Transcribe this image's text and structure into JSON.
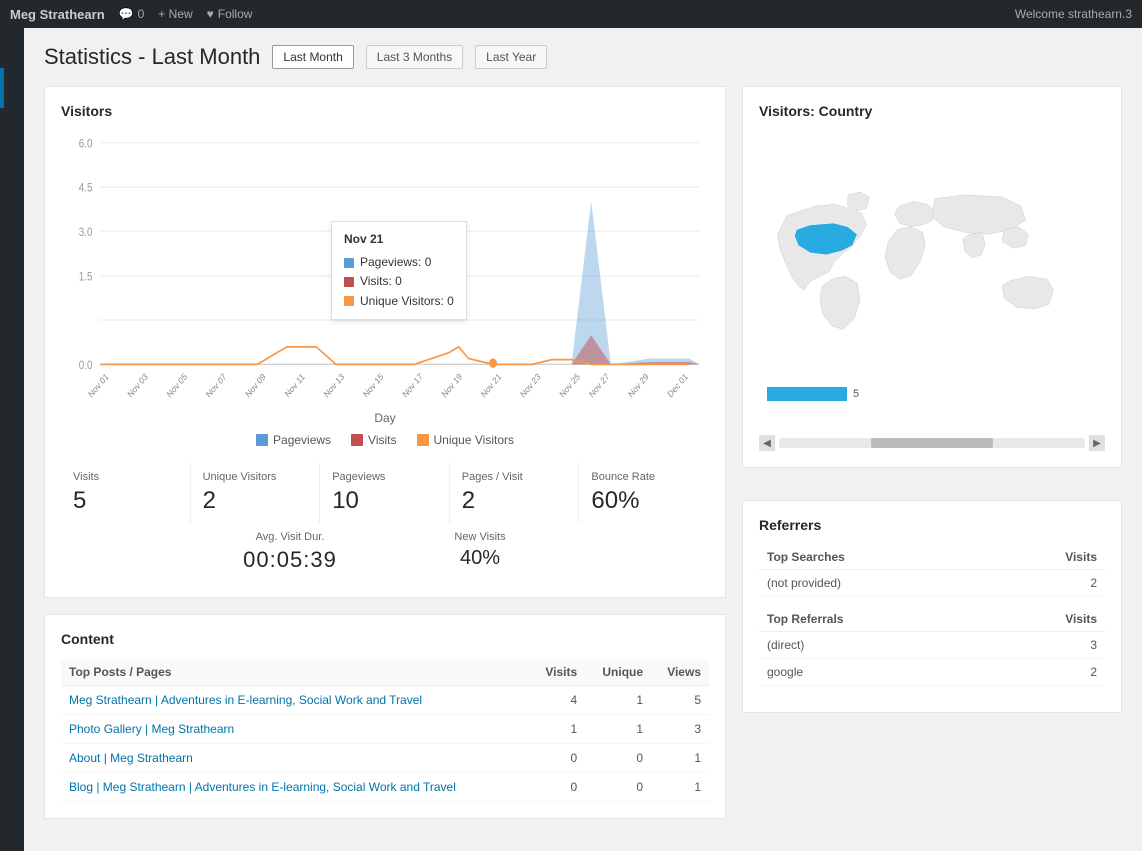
{
  "topbar": {
    "brand": "Meg Strathearn",
    "comment_icon": "💬",
    "comment_count": "0",
    "new_label": "+ New",
    "follow_icon": "♥",
    "follow_label": "Follow",
    "welcome_text": "Welcome strathearn.3"
  },
  "page_title": "Statistics - Last Month",
  "tabs": [
    {
      "id": "last-month",
      "label": "Last Month",
      "active": true
    },
    {
      "id": "last-3-months",
      "label": "Last 3 Months",
      "active": false
    },
    {
      "id": "last-year",
      "label": "Last Year",
      "active": false
    }
  ],
  "visitors_card": {
    "title": "Visitors",
    "y_labels": [
      "6.0",
      "4.5",
      "3.0",
      "1.5",
      "0.0"
    ],
    "x_labels": [
      "Nov 01",
      "Nov 03",
      "Nov 05",
      "Nov 07",
      "Nov 09",
      "Nov 11",
      "Nov 13",
      "Nov 15",
      "Nov 17",
      "Nov 19",
      "Nov 21",
      "Nov 23",
      "Nov 25",
      "Nov 27",
      "Nov 29",
      "Dec 01"
    ],
    "axis_label": "Day",
    "legend": [
      {
        "label": "Pageviews",
        "color": "#5b9bd5"
      },
      {
        "label": "Visits",
        "color": "#c0504d"
      },
      {
        "label": "Unique Visitors",
        "color": "#f79646"
      }
    ],
    "tooltip": {
      "date": "Nov 21",
      "pageviews_label": "Pageviews: 0",
      "visits_label": "Visits: 0",
      "unique_label": "Unique Visitors: 0"
    }
  },
  "stats": {
    "visits_label": "Visits",
    "visits_value": "5",
    "unique_label": "Unique Visitors",
    "unique_value": "2",
    "pageviews_label": "Pageviews",
    "pageviews_value": "10",
    "pages_visit_label": "Pages / Visit",
    "pages_visit_value": "2",
    "bounce_label": "Bounce Rate",
    "bounce_value": "60%",
    "avg_dur_label": "Avg. Visit Dur.",
    "avg_dur_value": "00:05:39",
    "new_visits_label": "New Visits",
    "new_visits_value": "40%"
  },
  "content_card": {
    "title": "Content",
    "table_headers": [
      "Top Posts / Pages",
      "Visits",
      "Unique",
      "Views"
    ],
    "rows": [
      {
        "title": "Meg Strathearn | Adventures in E-learning, Social Work and Travel",
        "visits": "4",
        "unique": "1",
        "views": "5"
      },
      {
        "title": "Photo Gallery | Meg Strathearn",
        "visits": "1",
        "unique": "1",
        "views": "3"
      },
      {
        "title": "About | Meg Strathearn",
        "visits": "0",
        "unique": "0",
        "views": "1"
      },
      {
        "title": "Blog | Meg Strathearn | Adventures in E-learning, Social Work and Travel",
        "visits": "0",
        "unique": "0",
        "views": "1"
      }
    ]
  },
  "visitors_country_card": {
    "title": "Visitors: Country",
    "country": "United States",
    "country_value": "5"
  },
  "referrers_card": {
    "title": "Referrers",
    "searches_header": "Top Searches",
    "searches_visits_header": "Visits",
    "searches": [
      {
        "term": "(not provided)",
        "visits": "2"
      }
    ],
    "referrals_header": "Top Referrals",
    "referrals_visits_header": "Visits",
    "referrals": [
      {
        "source": "(direct)",
        "visits": "3"
      },
      {
        "source": "google",
        "visits": "2"
      }
    ]
  }
}
